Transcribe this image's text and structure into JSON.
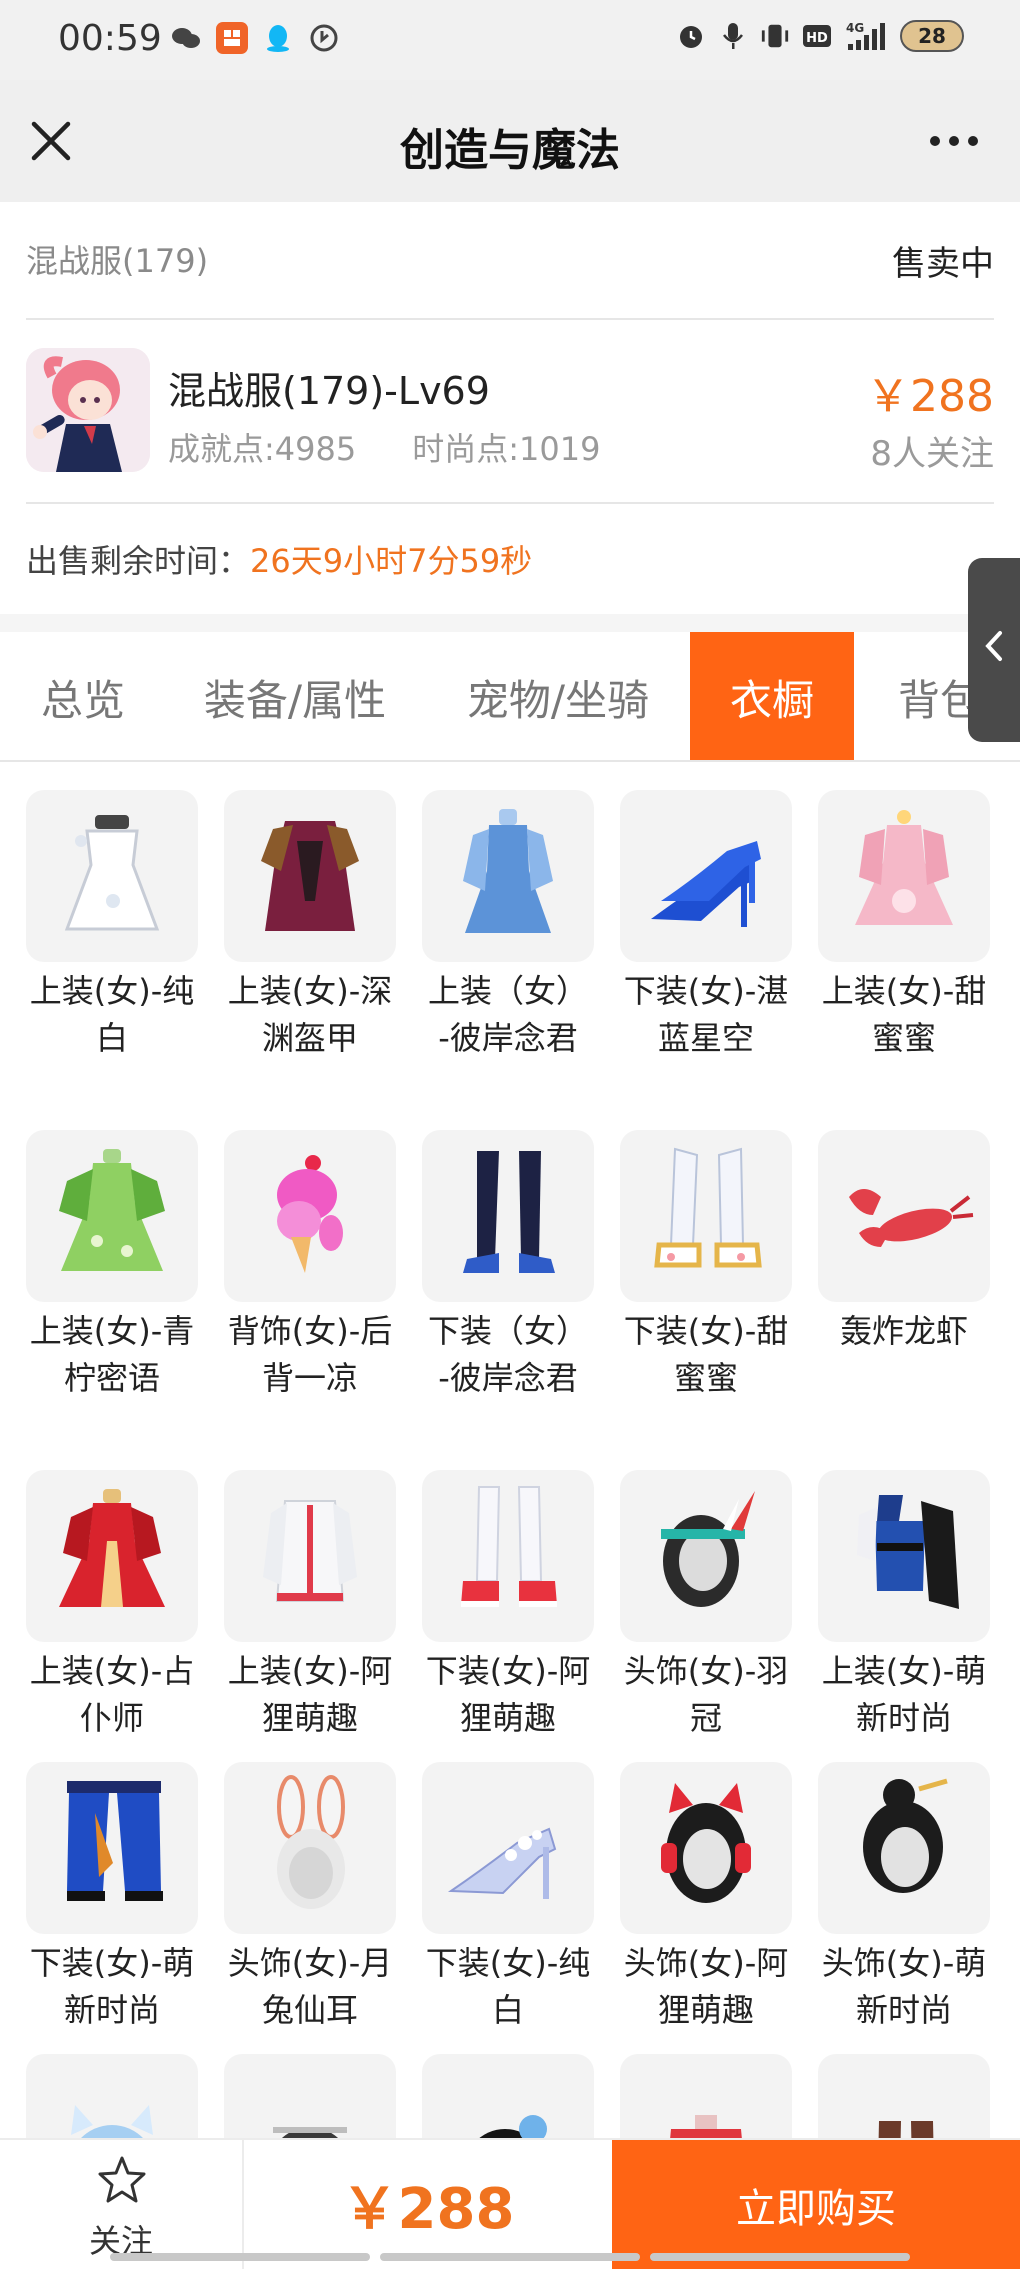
{
  "status_bar": {
    "time": "00:59",
    "battery": "28",
    "network": "4G"
  },
  "header": {
    "title": "创造与魔法"
  },
  "server": {
    "name": "混战服(179)",
    "status": "售卖中"
  },
  "character": {
    "name": "混战服(179)-Lv69",
    "achievement": "成就点:4985",
    "fashion": "时尚点:1019",
    "price": "￥288",
    "followers": "8人关注"
  },
  "timer": {
    "label": "出售剩余时间：",
    "value": "26天9小时7分59秒"
  },
  "tabs": [
    {
      "label": "总览"
    },
    {
      "label": "装备/属性"
    },
    {
      "label": "宠物/坐骑"
    },
    {
      "label": "衣橱"
    },
    {
      "label": "背包"
    }
  ],
  "items": [
    {
      "name": "上装(女)-纯白",
      "icon": "white-dress"
    },
    {
      "name": "上装(女)-深渊盔甲",
      "icon": "abyss-armor"
    },
    {
      "name": "上装（女）-彼岸念君",
      "icon": "blue-dress"
    },
    {
      "name": "下装(女)-湛蓝星空",
      "icon": "blue-heels"
    },
    {
      "name": "上装(女)-甜蜜蜜",
      "icon": "pink-dress"
    },
    {
      "name": "上装(女)-青柠密语",
      "icon": "green-dress"
    },
    {
      "name": "背饰(女)-后背一凉",
      "icon": "ice-cream"
    },
    {
      "name": "下装（女）-彼岸念君",
      "icon": "dark-stockings"
    },
    {
      "name": "下装(女)-甜蜜蜜",
      "icon": "white-boots"
    },
    {
      "name": "轰炸龙虾",
      "icon": "lobster"
    },
    {
      "name": "上装(女)-占仆师",
      "icon": "red-dress"
    },
    {
      "name": "上装(女)-阿狸萌趣",
      "icon": "white-jacket"
    },
    {
      "name": "下装(女)-阿狸萌趣",
      "icon": "white-boots-red"
    },
    {
      "name": "头饰(女)-羽冠",
      "icon": "feather-crown"
    },
    {
      "name": "上装(女)-萌新时尚",
      "icon": "blue-corset"
    },
    {
      "name": "下装(女)-萌新时尚",
      "icon": "blue-trousers"
    },
    {
      "name": "头饰(女)-月兔仙耳",
      "icon": "bunny-ears"
    },
    {
      "name": "下装(女)-纯白",
      "icon": "crystal-heels"
    },
    {
      "name": "头饰(女)-阿狸萌趣",
      "icon": "cat-headphones"
    },
    {
      "name": "头饰(女)-萌新时尚",
      "icon": "black-bun-hair"
    },
    {
      "name": "",
      "icon": "blue-hair-cat"
    },
    {
      "name": "",
      "icon": "dark-hair"
    },
    {
      "name": "",
      "icon": "black-hair-flower"
    },
    {
      "name": "",
      "icon": "red-hoodie"
    },
    {
      "name": "",
      "icon": "brown-pants"
    }
  ],
  "bottom": {
    "follow_label": "关注",
    "price": "￥288",
    "buy_label": "立即购买"
  },
  "colors": {
    "accent": "#ff6414",
    "price": "#f0731f"
  }
}
